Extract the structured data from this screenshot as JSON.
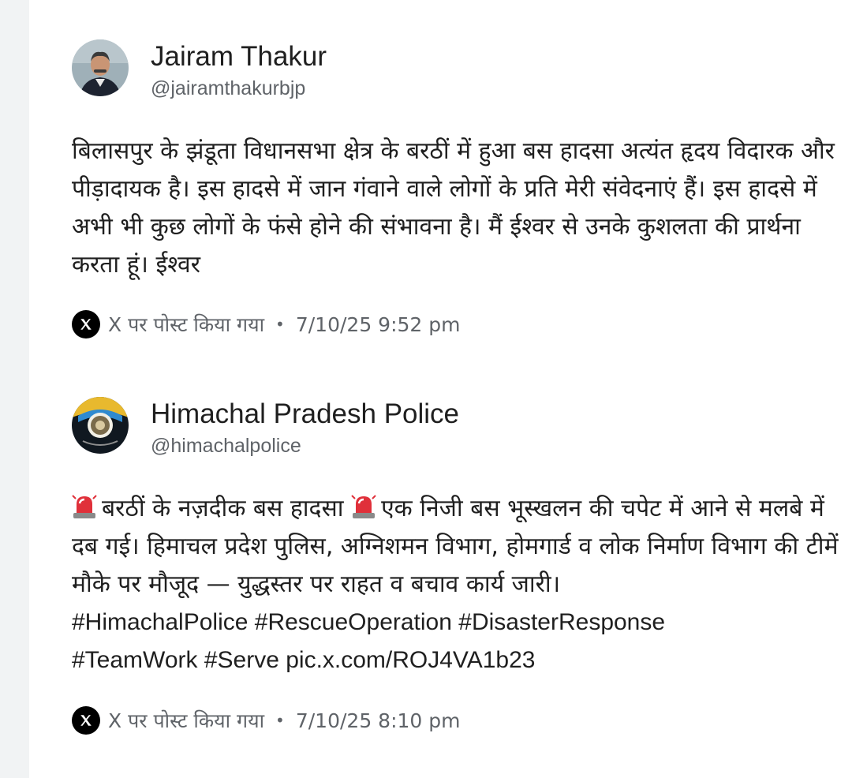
{
  "posts": [
    {
      "author": "Jairam Thakur",
      "handle": "@jairamthakurbjp",
      "text": "बिलासपुर के झंडूता विधानसभा क्षेत्र के बरठीं में हुआ बस हादसा अत्यंत हृदय विदारक और पीड़ादायक है। इस हादसे में जान गंवाने वाले लोगों के प्रति मेरी संवेदनाएं हैं। इस हादसे में अभी भी कुछ लोगों के फंसे होने की संभावना है। मैं ईश्वर से उनके कुशलता की प्रार्थना करता हूं। ईश्वर",
      "source": "X पर पोस्ट किया गया",
      "separator": "•",
      "timestamp": "7/10/25 9:52 pm",
      "avatar_icon": "person-portrait-icon"
    },
    {
      "author": "Himachal Pradesh Police",
      "handle": "@himachalpolice",
      "text_part1": "बरठीं के नज़दीक बस हादसा",
      "text_part2": "एक निजी बस भूस्खलन की चपेट में आने से मलबे में दब गई। हिमाचल प्रदेश पुलिस, अग्निशमन विभाग, होमगार्ड व लोक निर्माण विभाग की टीमें मौके पर मौजूद — युद्धस्तर पर राहत व बचाव कार्य जारी।",
      "hashtags_line1": "#HimachalPolice #RescueOperation #DisasterResponse",
      "hashtags_line2": "#TeamWork #Serve pic.x.com/ROJ4VA1b23",
      "source": "X पर पोस्ट किया गया",
      "separator": "•",
      "timestamp": "7/10/25 8:10 pm",
      "avatar_icon": "police-emblem-icon"
    }
  ],
  "icons": {
    "source_logo": "x-logo-icon",
    "siren": "siren-emoji-icon"
  },
  "colors": {
    "text": "#1f1f1f",
    "secondary": "#5f6368",
    "background": "#ffffff"
  }
}
